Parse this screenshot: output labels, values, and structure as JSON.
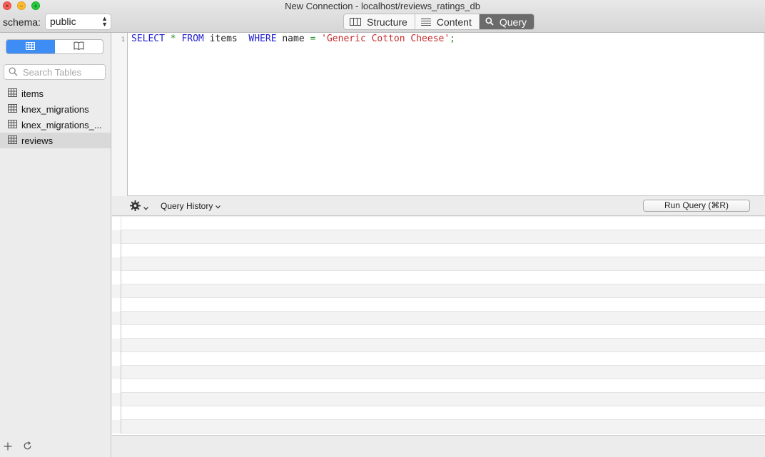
{
  "window": {
    "title": "New Connection - localhost/reviews_ratings_db"
  },
  "toolbar": {
    "schema_label": "schema:",
    "schema_value": "public",
    "tabs": [
      {
        "label": "Structure",
        "icon": "columns-icon"
      },
      {
        "label": "Content",
        "icon": "rows-icon"
      },
      {
        "label": "Query",
        "icon": "magnifier-icon"
      }
    ],
    "active_tab": "Query"
  },
  "sidebar": {
    "search_placeholder": "Search Tables",
    "tables": [
      {
        "name": "items"
      },
      {
        "name": "knex_migrations"
      },
      {
        "name": "knex_migrations_..."
      },
      {
        "name": "reviews"
      }
    ],
    "selected_table": "reviews"
  },
  "editor": {
    "line_number": "1",
    "query": "SELECT * FROM items  WHERE name = 'Generic Cotton Cheese';",
    "tokens": {
      "select": "SELECT",
      "star": "*",
      "from": "FROM",
      "table": "items",
      "where": "WHERE",
      "column": "name",
      "equals": "=",
      "value": "'Generic Cotton Cheese'",
      "semicolon": ";"
    }
  },
  "querybar": {
    "history_label": "Query History",
    "run_label": "Run Query (⌘R)"
  },
  "colors": {
    "keyword": "#2020d0",
    "operator": "#2a8f2a",
    "string": "#c92a2a",
    "active_tab_bg": "#6b6b6b",
    "toggle_active": "#3d8df5"
  }
}
